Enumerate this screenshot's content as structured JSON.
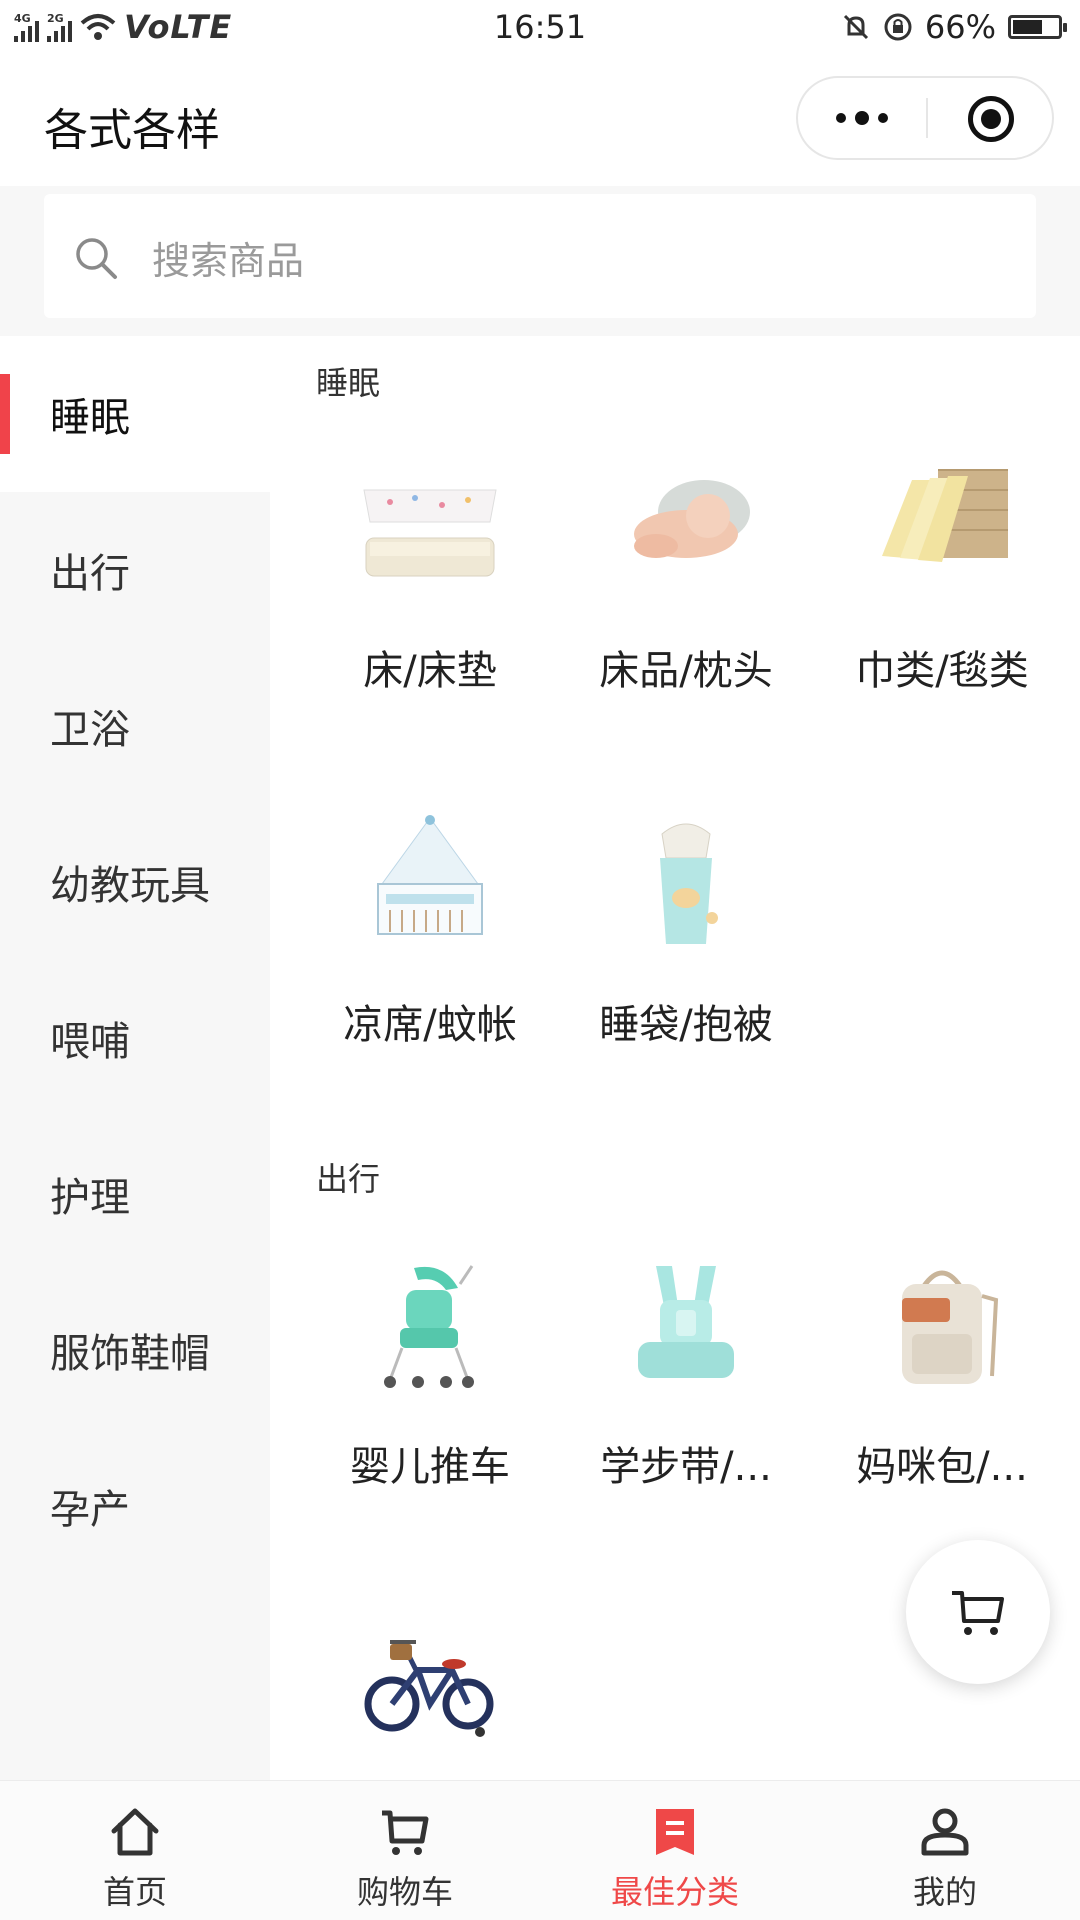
{
  "status_bar": {
    "network_1": "4G",
    "network_2": "2G",
    "volte": "VoLTE",
    "time": "16:51",
    "battery_text": "66%",
    "battery_level": 0.66
  },
  "header": {
    "title": "各式各样"
  },
  "search": {
    "placeholder": "搜索商品"
  },
  "sidebar": {
    "items": [
      {
        "label": "睡眠",
        "active": true
      },
      {
        "label": "出行",
        "active": false
      },
      {
        "label": "卫浴",
        "active": false
      },
      {
        "label": "幼教玩具",
        "active": false
      },
      {
        "label": "喂哺",
        "active": false
      },
      {
        "label": "护理",
        "active": false
      },
      {
        "label": "服饰鞋帽",
        "active": false
      },
      {
        "label": "孕产",
        "active": false
      }
    ]
  },
  "sections": [
    {
      "title": "睡眠",
      "items": [
        {
          "label": "床/床垫",
          "icon": "mattress-image"
        },
        {
          "label": "床品/枕头",
          "icon": "baby-pillow-image"
        },
        {
          "label": "巾类/毯类",
          "icon": "towel-image"
        },
        {
          "label": "凉席/蚊帐",
          "icon": "crib-mosquito-net-image"
        },
        {
          "label": "睡袋/抱被",
          "icon": "swaddle-image"
        }
      ]
    },
    {
      "title": "出行",
      "items": [
        {
          "label": "婴儿推车",
          "icon": "stroller-image"
        },
        {
          "label": "学步带/...",
          "icon": "carrier-image"
        },
        {
          "label": "妈咪包/...",
          "icon": "diaper-bag-image"
        },
        {
          "label": "",
          "icon": "kids-bike-image"
        }
      ]
    }
  ],
  "tabbar": {
    "tabs": [
      {
        "label": "首页",
        "icon": "home-icon",
        "active": false
      },
      {
        "label": "购物车",
        "icon": "cart-icon",
        "active": false
      },
      {
        "label": "最佳分类",
        "icon": "category-icon",
        "active": true
      },
      {
        "label": "我的",
        "icon": "profile-icon",
        "active": false
      }
    ]
  },
  "colors": {
    "accent": "#ef4848",
    "sidebar_bg": "#f7f7f7"
  }
}
